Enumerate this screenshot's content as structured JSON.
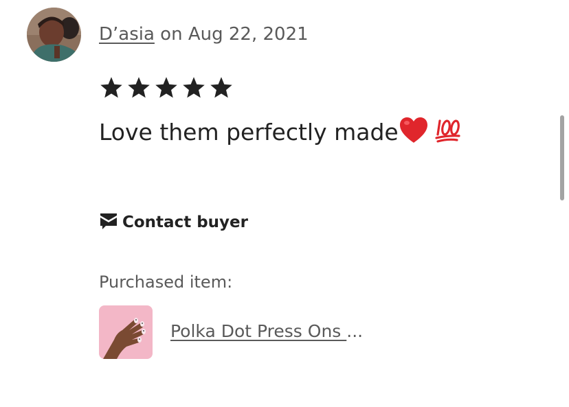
{
  "review": {
    "reviewer_name": "D’asia",
    "date_text": " on Aug 22, 2021",
    "rating": 5,
    "rating_max": 5,
    "text": "Love them perfectly made",
    "emojis": [
      "red-heart-emoji",
      "hundred-points-emoji"
    ]
  },
  "actions": {
    "contact_label": "Contact buyer",
    "contact_icon": "envelope-icon"
  },
  "purchase": {
    "label": "Purchased item:",
    "item_title": "Polka Dot Press Ons ",
    "item_ellipsis": "..."
  },
  "colors": {
    "text_primary": "#222222",
    "text_secondary": "#595959",
    "star": "#222222",
    "heart": "#e0262c",
    "hundred": "#e0262c",
    "thumb_bg": "#f3b7c7",
    "scrollbar": "#a3a3a3"
  }
}
